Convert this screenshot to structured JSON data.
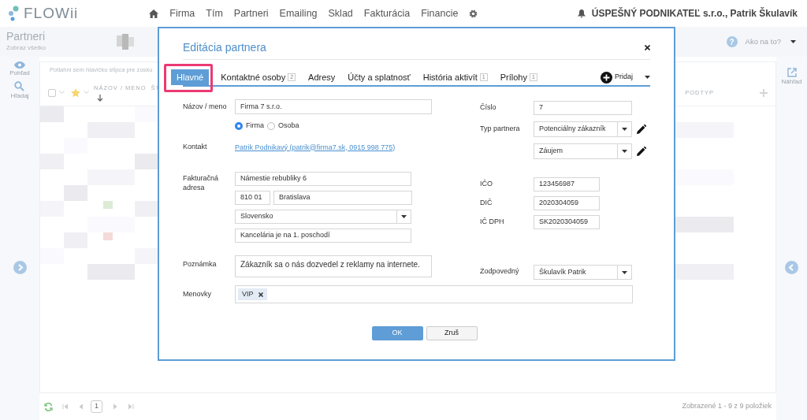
{
  "navbar": {
    "brand": "FLOWii",
    "menu": [
      {
        "label": "Firma"
      },
      {
        "label": "Tím"
      },
      {
        "label": "Partneri"
      },
      {
        "label": "Emailing"
      },
      {
        "label": "Sklad"
      },
      {
        "label": "Fakturácia"
      },
      {
        "label": "Financie"
      }
    ],
    "account": "ÚSPEŠNÝ PODNIKATEĽ s.r.o., Patrik Škulavík"
  },
  "page_header": {
    "title": "Partneri",
    "subtitle": "Zobraz všetko",
    "help_icon": "?",
    "help": "Ako na to?"
  },
  "sidebar_left": [
    {
      "label": "Pohľad",
      "kind": "eye"
    },
    {
      "label": "Hľadaj",
      "kind": "search"
    }
  ],
  "sidebar_right": [
    {
      "label": "Náhľad"
    }
  ],
  "grid": {
    "group_hint": "Potiahni sem hlavičku stĺpca pre zosku",
    "select_all_checked": false,
    "columns": [
      "NÁZOV / MENO",
      "ŠT",
      "PODTYP"
    ]
  },
  "pager": {
    "page": "1",
    "summary": "Zobrazené 1 - 9 z 9 položiek"
  },
  "modal": {
    "title": "Editácia partnera",
    "tabs": [
      {
        "label": "Hlavné",
        "selected": true
      },
      {
        "label": "Kontaktné osoby",
        "count": "2",
        "selected": false
      },
      {
        "label": "Adresy",
        "selected": false
      },
      {
        "label": "Účty a splatnosť",
        "selected": false
      },
      {
        "label": "História aktivít",
        "count": "1",
        "selected": false
      },
      {
        "label": "Prílohy",
        "count": "1",
        "selected": false
      }
    ],
    "add": "Pridaj",
    "name": {
      "label": "Názov / meno",
      "value": "Firma 7 s.r.o."
    },
    "partner_kind": [
      {
        "label": "Firma",
        "selected": true
      },
      {
        "label": "Osoba",
        "selected": false
      }
    ],
    "contact": {
      "label": "Kontakt",
      "link": "Patrik Podnikavý (patrik@firma7.sk, 0915 998 775)"
    },
    "address": {
      "label": "Fakturačná adresa",
      "street": "Námestie rebubliky 6",
      "zip": "810 01",
      "city": "Bratislava",
      "country": "Slovensko",
      "note": "Kancelária je na 1. poschodí"
    },
    "number": {
      "label": "Číslo",
      "value": "7"
    },
    "partner_type": {
      "label": "Typ partnera",
      "value": "Potenciálny zákazník",
      "stage": "Záujem"
    },
    "ids": [
      {
        "label": "IČO",
        "value": "123456987"
      },
      {
        "label": "DIČ",
        "value": "2020304059"
      },
      {
        "label": "IČ DPH",
        "value": "SK2020304059"
      }
    ],
    "note": {
      "label": "Poznámka",
      "value": "Zákazník sa o nás dozvedel z reklamy na internete."
    },
    "owner": {
      "label": "Zodpovedný",
      "value": "Škulavík Patrik"
    },
    "tags": {
      "label": "Menovky",
      "items": [
        "VIP"
      ]
    },
    "buttons": [
      {
        "label": "OK",
        "kind": "primary"
      },
      {
        "label": "Zruš",
        "kind": "secondary"
      }
    ]
  }
}
